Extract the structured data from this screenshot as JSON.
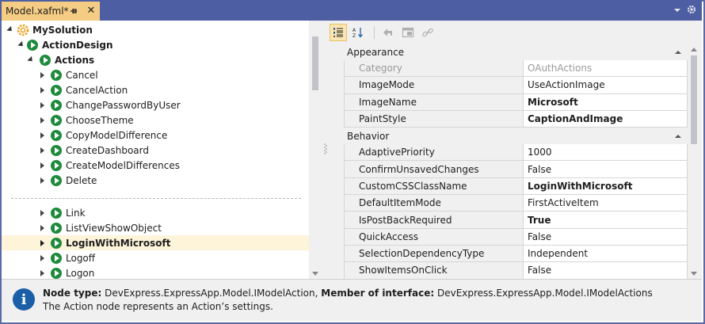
{
  "tab": {
    "title": "Model.xafml*"
  },
  "tree": {
    "root": "MySolution",
    "action_design": "ActionDesign",
    "actions": "Actions",
    "items_top": [
      "Cancel",
      "CancelAction",
      "ChangePasswordByUser",
      "ChooseTheme",
      "CopyModelDifference",
      "CreateDashboard",
      "CreateModelDifferences",
      "Delete"
    ],
    "items_bottom": [
      "Link",
      "ListViewShowObject",
      "LoginWithMicrosoft",
      "Logoff",
      "Logon"
    ],
    "selected": "LoginWithMicrosoft"
  },
  "grid": {
    "categories": {
      "appearance": "Appearance",
      "behavior": "Behavior"
    },
    "appearance_props": [
      {
        "name": "Category",
        "value": "OAuthActions"
      },
      {
        "name": "ImageMode",
        "value": "UseActionImage"
      },
      {
        "name": "ImageName",
        "value": "Microsoft"
      },
      {
        "name": "PaintStyle",
        "value": "CaptionAndImage"
      }
    ],
    "behavior_props": [
      {
        "name": "AdaptivePriority",
        "value": "1000"
      },
      {
        "name": "ConfirmUnsavedChanges",
        "value": "False"
      },
      {
        "name": "CustomCSSClassName",
        "value": "LoginWithMicrosoft"
      },
      {
        "name": "DefaultItemMode",
        "value": "FirstActiveItem"
      },
      {
        "name": "IsPostBackRequired",
        "value": "True"
      },
      {
        "name": "QuickAccess",
        "value": "False"
      },
      {
        "name": "SelectionDependencyType",
        "value": "Independent"
      },
      {
        "name": "ShowItemsOnClick",
        "value": "False"
      }
    ]
  },
  "info": {
    "node_type_label": "Node type:",
    "node_type_value": "DevExpress.ExpressApp.Model.IModelAction,",
    "member_label": "Member of interface:",
    "member_value": "DevExpress.ExpressApp.Model.IModelActions",
    "description": "The Action node represents an Action’s settings."
  },
  "colors": {
    "tab_active": "#f5cc84",
    "title_bar": "#4e5ea3",
    "selected_row": "#fdf4da",
    "action_icon": "#1e8a3c",
    "info_icon": "#1b5fa8"
  },
  "icons": {
    "tab_pin": "pin-icon",
    "tab_close": "close-icon",
    "window_dropdown": "chevron-down-icon",
    "window_settings": "gear-icon",
    "root_node": "gear-icon",
    "action_node": "play-icon",
    "toolbar": [
      "categorized-icon",
      "alphabetical-icon",
      "back-icon",
      "window-icon",
      "link-icon"
    ],
    "info": "info-icon"
  }
}
